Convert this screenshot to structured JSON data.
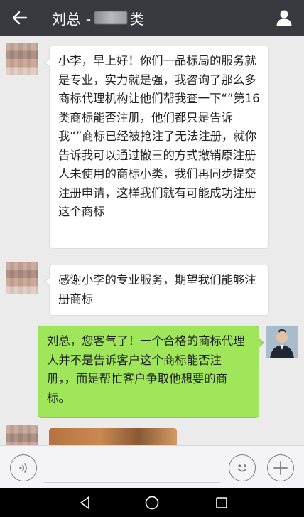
{
  "header": {
    "title_prefix": "刘总 - ",
    "title_suffix": "类"
  },
  "messages": [
    {
      "sender": "other",
      "text": "小李，早上好！你们一品标局的服务就是专业，实力就是强，我咨询了那么多商标代理机构让他们帮我查一下“”第16类商标能否注册，他们都只是告诉我“”商标已经被抢注了无法注册，就你告诉我可以通过撤三的方式撤销原注册人未使用的商标小类，我们再同步提交注册申请，这样我们就有可能成功注册这个商标"
    },
    {
      "sender": "other",
      "text": "感谢小李的专业服务，期望我们能够注册商标"
    },
    {
      "sender": "me",
      "text": "刘总，您客气了！一个合格的商标代理人并不是告诉客户这个商标能否注册，，而是帮忙客户争取他想要的商标。"
    }
  ],
  "colors": {
    "header_bg": "#393a3f",
    "chat_bg": "#ebebeb",
    "incoming_bubble": "#ffffff",
    "outgoing_bubble": "#9fe65b"
  },
  "icons": {
    "back": "arrow-left-icon",
    "profile": "person-icon",
    "voice": "voice-icon",
    "emoji": "emoji-icon",
    "more": "plus-icon",
    "nav_back": "triangle-back-icon",
    "nav_home": "circle-home-icon",
    "nav_recent": "square-recent-icon"
  }
}
